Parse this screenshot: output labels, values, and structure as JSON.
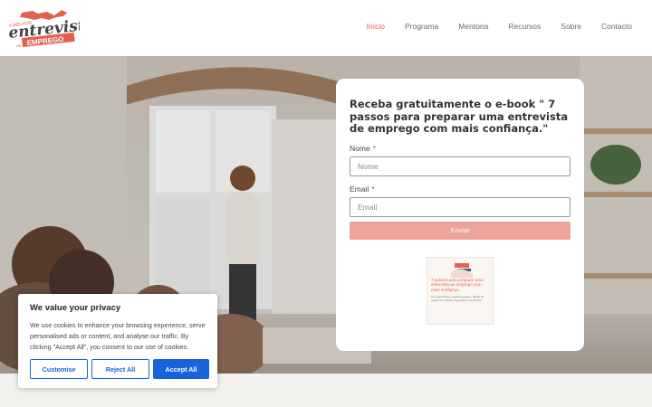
{
  "header": {
    "logo": {
      "top_text": "o MELHOR",
      "main_text": "entrevista",
      "ribbon_left": "DE",
      "ribbon_text": "EMPREGO",
      "brand_color": "#e0624c"
    },
    "nav": [
      {
        "label": "Início",
        "active": true
      },
      {
        "label": "Programa",
        "active": false
      },
      {
        "label": "Mentoria",
        "active": false
      },
      {
        "label": "Recursos",
        "active": false
      },
      {
        "label": "Sobre",
        "active": false
      },
      {
        "label": "Contacto",
        "active": false
      }
    ]
  },
  "form": {
    "title": "Receba gratuitamente o e-book \" 7 passos para preparar uma entrevista de emprego com mais confiança.\"",
    "name_label": "Nome",
    "name_placeholder": "Nome",
    "email_label": "Email",
    "email_placeholder": "Email",
    "required_mark": "*",
    "submit_label": "Enviar",
    "submit_color": "#eea39a",
    "ebook": {
      "title": "7 passos para preparar uma entrevista de emprego com mais confiança",
      "subtitle": "Um guia prático e passo-a-passo, rápido de seguir com ideias, sugestões e exercícios."
    }
  },
  "cookie": {
    "title": "We value your privacy",
    "text": "We use cookies to enhance your browsing experience, serve personalised ads or content, and analyse our traffic. By clicking \"Accept All\", you consent to our use of cookies.",
    "buttons": {
      "customise": "Customise",
      "reject": "Reject All",
      "accept": "Accept All"
    },
    "accent_color": "#1863dc"
  }
}
